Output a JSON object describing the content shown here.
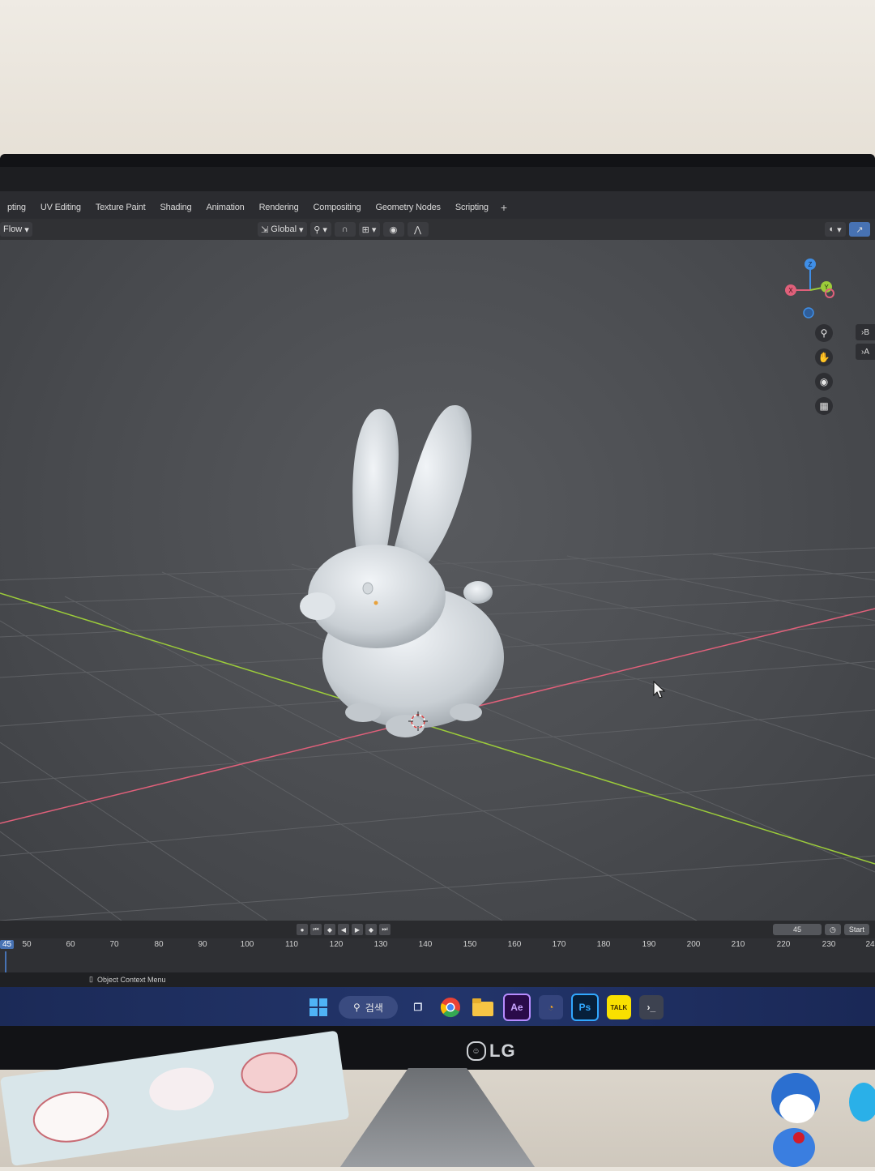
{
  "workspace_tabs": [
    "pting",
    "UV Editing",
    "Texture Paint",
    "Shading",
    "Animation",
    "Rendering",
    "Compositing",
    "Geometry Nodes",
    "Scripting"
  ],
  "workspace_add": "+",
  "header": {
    "mode": "Flow",
    "orientation": "Global"
  },
  "side_tabs": [
    "B",
    "A"
  ],
  "nav_icons": [
    "zoom-icon",
    "pan-hand-icon",
    "camera-icon",
    "grid-icon"
  ],
  "gizmo_axes": {
    "x": "X",
    "y": "Y",
    "z": "Z"
  },
  "timeline": {
    "current_frame": "45",
    "ticks": [
      "50",
      "60",
      "70",
      "80",
      "90",
      "100",
      "110",
      "120",
      "130",
      "140",
      "150",
      "160",
      "170",
      "180",
      "190",
      "200",
      "210",
      "220",
      "230",
      "24"
    ],
    "frame_field": "45",
    "start_label": "Start"
  },
  "status": {
    "context_menu": "Object Context Menu"
  },
  "taskbar": {
    "search_label": "검색",
    "ae": "Ae",
    "ps": "Ps",
    "talk": "TALK"
  },
  "brand": "LG",
  "colors": {
    "x_axis": "#e0607a",
    "y_axis": "#9ccc3a",
    "z_axis": "#3f8ee6",
    "accent": "#4772b3"
  }
}
